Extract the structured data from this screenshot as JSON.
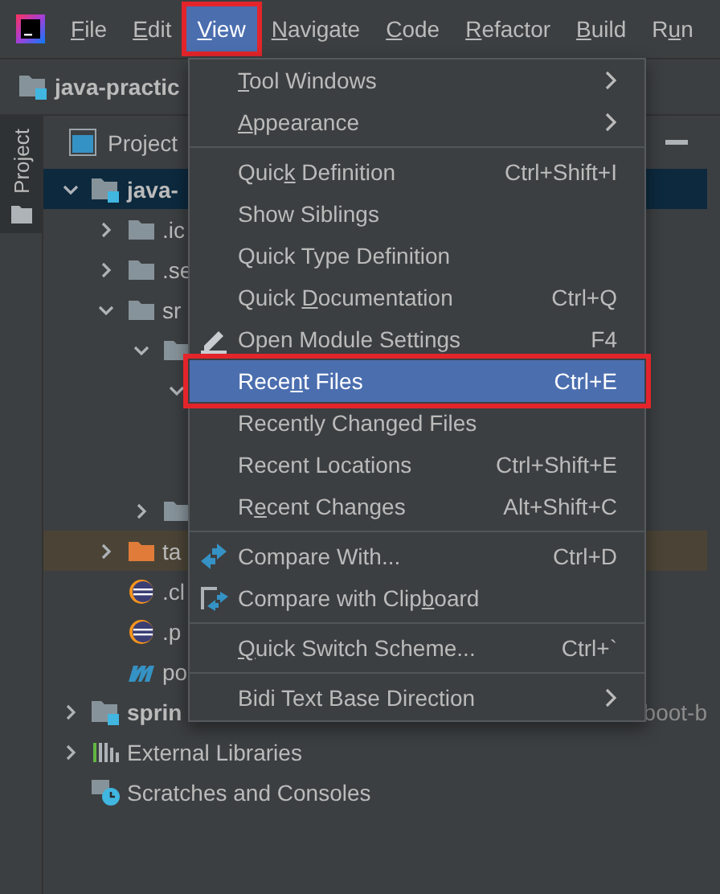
{
  "menubar": {
    "items": [
      {
        "parts": [
          {
            "text": "F",
            "underlined": true
          },
          {
            "text": "ile",
            "underlined": false
          }
        ],
        "selected": false,
        "highlighted": false
      },
      {
        "parts": [
          {
            "text": "E",
            "underlined": true
          },
          {
            "text": "dit",
            "underlined": false
          }
        ],
        "selected": false,
        "highlighted": false
      },
      {
        "parts": [
          {
            "text": "V",
            "underlined": true
          },
          {
            "text": "iew",
            "underlined": false
          }
        ],
        "selected": true,
        "highlighted": true
      },
      {
        "parts": [
          {
            "text": "N",
            "underlined": true
          },
          {
            "text": "avigate",
            "underlined": false
          }
        ],
        "selected": false,
        "highlighted": false
      },
      {
        "parts": [
          {
            "text": "C",
            "underlined": true
          },
          {
            "text": "ode",
            "underlined": false
          }
        ],
        "selected": false,
        "highlighted": false
      },
      {
        "parts": [
          {
            "text": "R",
            "underlined": true
          },
          {
            "text": "efactor",
            "underlined": false
          }
        ],
        "selected": false,
        "highlighted": false
      },
      {
        "parts": [
          {
            "text": "B",
            "underlined": true
          },
          {
            "text": "uild",
            "underlined": false
          }
        ],
        "selected": false,
        "highlighted": false
      },
      {
        "parts": [
          {
            "text": "R",
            "underlined": false
          },
          {
            "text": "u",
            "underlined": true
          },
          {
            "text": "n",
            "underlined": false
          }
        ],
        "selected": false,
        "highlighted": false
      }
    ]
  },
  "navbar": {
    "project": "java-practic"
  },
  "tool_tabs": [
    {
      "label": "Project",
      "selected": true
    }
  ],
  "panel": {
    "title": "Project"
  },
  "tree": [
    {
      "label": "java-",
      "kind": "module",
      "expanded": true,
      "selected": true,
      "ignored": false,
      "children": [
        {
          "label": ".ic",
          "kind": "folder",
          "expanded": false,
          "selected": false,
          "ignored": false
        },
        {
          "label": ".se",
          "kind": "folder",
          "expanded": false,
          "selected": false,
          "ignored": false
        },
        {
          "label": "sr",
          "kind": "folder",
          "expanded": true,
          "selected": false,
          "ignored": false,
          "children": [
            {
              "kind": "folder",
              "expanded": true,
              "selected": false,
              "ignored": false,
              "children": [
                {
                  "expanded": true,
                  "selected": false,
                  "ignored": false
                }
              ]
            },
            {
              "kind": "folder",
              "expanded": false,
              "selected": false,
              "ignored": false
            }
          ]
        },
        {
          "label": "ta",
          "kind": "folder-excluded",
          "expanded": false,
          "selected": false,
          "ignored": true
        },
        {
          "label": ".cl",
          "kind": "eclipse",
          "selected": false,
          "ignored": false
        },
        {
          "label": ".p",
          "kind": "eclipse",
          "selected": false,
          "ignored": false
        },
        {
          "label": "po",
          "kind": "maven",
          "selected": false,
          "ignored": false
        }
      ]
    },
    {
      "label": "sprin",
      "path": "boot-b",
      "kind": "module",
      "expanded": false,
      "selected": false,
      "ignored": false
    },
    {
      "label": "External Libraries",
      "kind": "libraries",
      "expanded": false,
      "selected": false,
      "ignored": false
    },
    {
      "label": "Scratches and Consoles",
      "kind": "scratches",
      "selected": false,
      "ignored": false
    }
  ],
  "menu": {
    "items": [
      {
        "kind": "item",
        "parts": [
          {
            "text": "T",
            "underlined": true
          },
          {
            "text": "ool Windows",
            "underlined": false
          }
        ],
        "submenu": true,
        "selected": false,
        "highlighted": false
      },
      {
        "kind": "item",
        "parts": [
          {
            "text": "A",
            "underlined": true
          },
          {
            "text": "ppearance",
            "underlined": false
          }
        ],
        "submenu": true,
        "selected": false,
        "highlighted": false
      },
      {
        "kind": "separator"
      },
      {
        "kind": "item",
        "parts": [
          {
            "text": "Quic",
            "underlined": false
          },
          {
            "text": "k",
            "underlined": true
          },
          {
            "text": " Definition",
            "underlined": false
          }
        ],
        "shortcut": "Ctrl+Shift+I",
        "submenu": false,
        "selected": false,
        "highlighted": false
      },
      {
        "kind": "item",
        "parts": [
          {
            "text": "Show Siblings",
            "underlined": false
          }
        ],
        "submenu": false,
        "selected": false,
        "highlighted": false
      },
      {
        "kind": "item",
        "parts": [
          {
            "text": "Quick Type Definition",
            "underlined": false
          }
        ],
        "submenu": false,
        "selected": false,
        "highlighted": false
      },
      {
        "kind": "item",
        "parts": [
          {
            "text": "Quick ",
            "underlined": false
          },
          {
            "text": "D",
            "underlined": true
          },
          {
            "text": "ocumentation",
            "underlined": false
          }
        ],
        "shortcut": "Ctrl+Q",
        "submenu": false,
        "selected": false,
        "highlighted": false
      },
      {
        "kind": "edit",
        "parts": [
          {
            "text": "Open Module Settings",
            "underlined": false
          }
        ],
        "shortcut": "F4",
        "submenu": false,
        "selected": false,
        "highlighted": false
      },
      {
        "kind": "item",
        "parts": [
          {
            "text": "Rece",
            "underlined": false
          },
          {
            "text": "n",
            "underlined": true
          },
          {
            "text": "t Files",
            "underlined": false
          }
        ],
        "shortcut": "Ctrl+E",
        "submenu": false,
        "selected": true,
        "highlighted": true
      },
      {
        "kind": "item",
        "parts": [
          {
            "text": "Recently Changed Files",
            "underlined": false
          }
        ],
        "submenu": false,
        "selected": false,
        "highlighted": false
      },
      {
        "kind": "item",
        "parts": [
          {
            "text": "Recent Locations",
            "underlined": false
          }
        ],
        "shortcut": "Ctrl+Shift+E",
        "submenu": false,
        "selected": false,
        "highlighted": false
      },
      {
        "kind": "item",
        "parts": [
          {
            "text": "R",
            "underlined": false
          },
          {
            "text": "e",
            "underlined": true
          },
          {
            "text": "cent Changes",
            "underlined": false
          }
        ],
        "shortcut": "Alt+Shift+C",
        "submenu": false,
        "selected": false,
        "highlighted": false
      },
      {
        "kind": "separator"
      },
      {
        "kind": "compare",
        "parts": [
          {
            "text": "Compare With...",
            "underlined": false
          }
        ],
        "shortcut": "Ctrl+D",
        "submenu": false,
        "selected": false,
        "highlighted": false
      },
      {
        "kind": "paste",
        "parts": [
          {
            "text": "Compare with Clip",
            "underlined": false
          },
          {
            "text": "b",
            "underlined": true
          },
          {
            "text": "oard",
            "underlined": false
          }
        ],
        "submenu": false,
        "selected": false,
        "highlighted": false
      },
      {
        "kind": "separator"
      },
      {
        "kind": "item",
        "parts": [
          {
            "text": "Q",
            "underlined": true
          },
          {
            "text": "uick Switch Scheme...",
            "underlined": false
          }
        ],
        "shortcut": "Ctrl+`",
        "submenu": false,
        "selected": false,
        "highlighted": false
      },
      {
        "kind": "separator"
      },
      {
        "kind": "item",
        "parts": [
          {
            "text": "Bidi Text Base Direction",
            "underlined": false
          }
        ],
        "submenu": true,
        "selected": false,
        "highlighted": false
      }
    ]
  }
}
